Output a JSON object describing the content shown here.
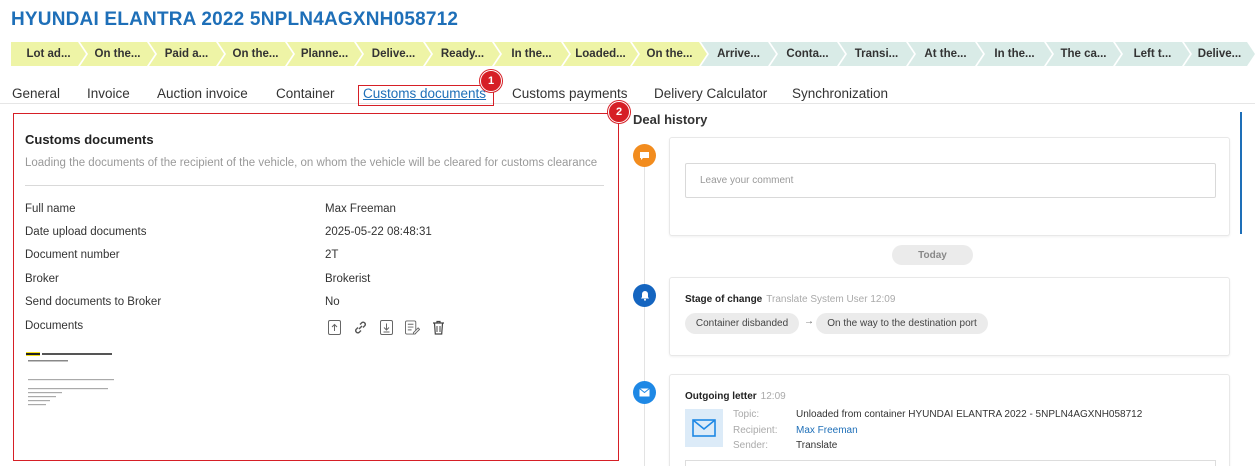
{
  "header": {
    "title": "HYUNDAI ELANTRA 2022 5NPLN4AGXNH058712"
  },
  "stages": [
    {
      "label": "Lot ad...",
      "state": "done"
    },
    {
      "label": "On the...",
      "state": "done"
    },
    {
      "label": "Paid a...",
      "state": "done"
    },
    {
      "label": "On the...",
      "state": "done"
    },
    {
      "label": "Planne...",
      "state": "done"
    },
    {
      "label": "Delive...",
      "state": "done"
    },
    {
      "label": "Ready...",
      "state": "done"
    },
    {
      "label": "In the...",
      "state": "done"
    },
    {
      "label": "Loaded...",
      "state": "done"
    },
    {
      "label": "On the...",
      "state": "done"
    },
    {
      "label": "Arrive...",
      "state": "pending"
    },
    {
      "label": "Conta...",
      "state": "pending"
    },
    {
      "label": "Transi...",
      "state": "pending"
    },
    {
      "label": "At the...",
      "state": "pending"
    },
    {
      "label": "In the...",
      "state": "pending"
    },
    {
      "label": "The ca...",
      "state": "pending"
    },
    {
      "label": "Left t...",
      "state": "pending"
    },
    {
      "label": "Delive...",
      "state": "pending"
    }
  ],
  "tabs": [
    {
      "label": "General"
    },
    {
      "label": "Invoice"
    },
    {
      "label": "Auction invoice"
    },
    {
      "label": "Container"
    },
    {
      "label": "Customs documents",
      "active": true
    },
    {
      "label": "Customs payments"
    },
    {
      "label": "Delivery Calculator"
    },
    {
      "label": "Synchronization"
    }
  ],
  "annotations": {
    "badge1": "1",
    "badge2": "2"
  },
  "customs": {
    "title": "Customs documents",
    "subtitle": "Loading the documents of the recipient of the vehicle, on whom the vehicle will be cleared for customs clearance",
    "fields": [
      {
        "label": "Full name",
        "value": "Max Freeman"
      },
      {
        "label": "Date upload documents",
        "value": "2025-05-22 08:48:31"
      },
      {
        "label": "Document number",
        "value": "2T"
      },
      {
        "label": "Broker",
        "value": "Brokerist"
      },
      {
        "label": "Send documents to Broker",
        "value": "No"
      },
      {
        "label": "Documents",
        "value": ""
      }
    ],
    "doc_icons": [
      "upload-icon",
      "link-icon",
      "download-icon",
      "edit-document-icon",
      "trash-icon"
    ]
  },
  "deal_history": {
    "title": "Deal history",
    "comment_placeholder": "Leave your comment",
    "today_label": "Today",
    "stage_change": {
      "title": "Stage of change",
      "meta": "Translate System User 12:09",
      "from": "Container disbanded",
      "arrow": "→",
      "to": "On the way to the destination port"
    },
    "letter": {
      "title": "Outgoing letter",
      "time": "12:09",
      "topic_label": "Topic:",
      "topic": "Unloaded from container HYUNDAI ELANTRA 2022 - 5NPLN4AGXNH058712",
      "recipient_label": "Recipient:",
      "recipient": "Max Freeman",
      "sender_label": "Sender:",
      "sender": "Translate"
    }
  },
  "colors": {
    "accent": "#1e6fb8",
    "annotation": "#d61f26",
    "stage_done": "#eef4a6",
    "stage_pending": "#d9ebe7",
    "comment_dot": "#f28c1e",
    "stage_dot": "#1565c0",
    "letter_dot": "#1e88e5"
  }
}
